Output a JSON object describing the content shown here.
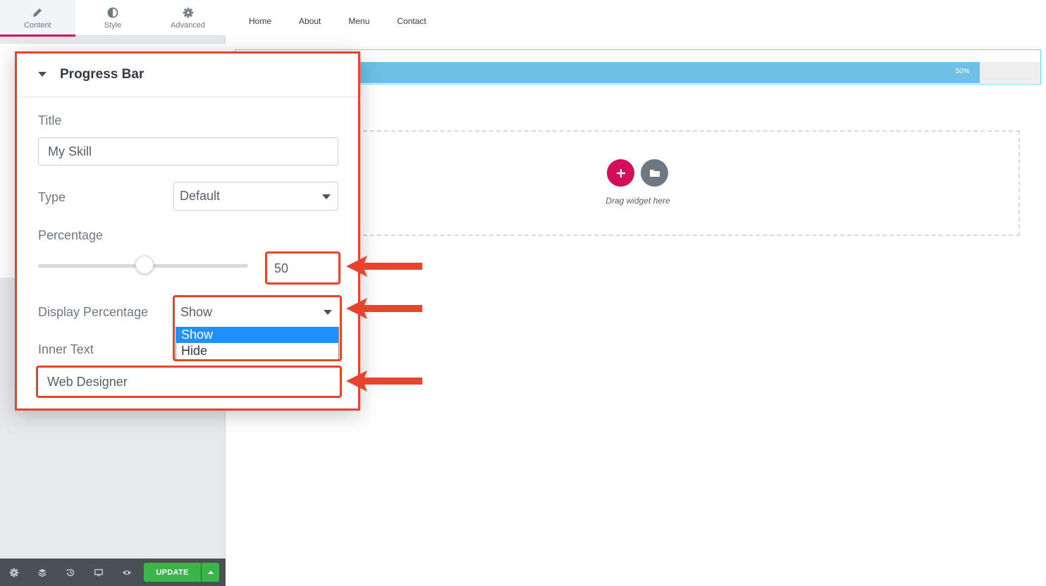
{
  "editor_tabs": [
    {
      "label": "Content",
      "icon": "pencil-icon",
      "active": true
    },
    {
      "label": "Style",
      "icon": "contrast-icon",
      "active": false
    },
    {
      "label": "Advanced",
      "icon": "gear-icon",
      "active": false
    }
  ],
  "nav": {
    "items": [
      "Home",
      "About",
      "Menu",
      "Contact"
    ]
  },
  "preview": {
    "progress": {
      "percent": 50,
      "label": "50%",
      "fill_color": "#6ec1e4",
      "track_color": "#eeeeee"
    },
    "drop_zone": {
      "label": "Drag widget here"
    }
  },
  "panel": {
    "title": "Progress Bar",
    "fields": {
      "title": {
        "label": "Title",
        "value": "My Skill"
      },
      "type": {
        "label": "Type",
        "value": "Default"
      },
      "percentage": {
        "label": "Percentage",
        "value": "50",
        "slider_fraction": 0.5
      },
      "display_percentage": {
        "label": "Display Percentage",
        "value": "Show",
        "options": [
          "Show",
          "Hide"
        ],
        "highlighted": "Show"
      },
      "inner_text": {
        "label": "Inner Text",
        "value": "Web Designer"
      }
    },
    "highlight_color": "#e8432d"
  },
  "footer": {
    "icons": [
      "settings-icon",
      "layers-icon",
      "history-icon",
      "responsive-icon",
      "preview-icon"
    ],
    "update_label": "UPDATE",
    "update_color": "#39b54a"
  },
  "colors": {
    "accent": "#d30c5c",
    "toolbar": "#495157"
  }
}
